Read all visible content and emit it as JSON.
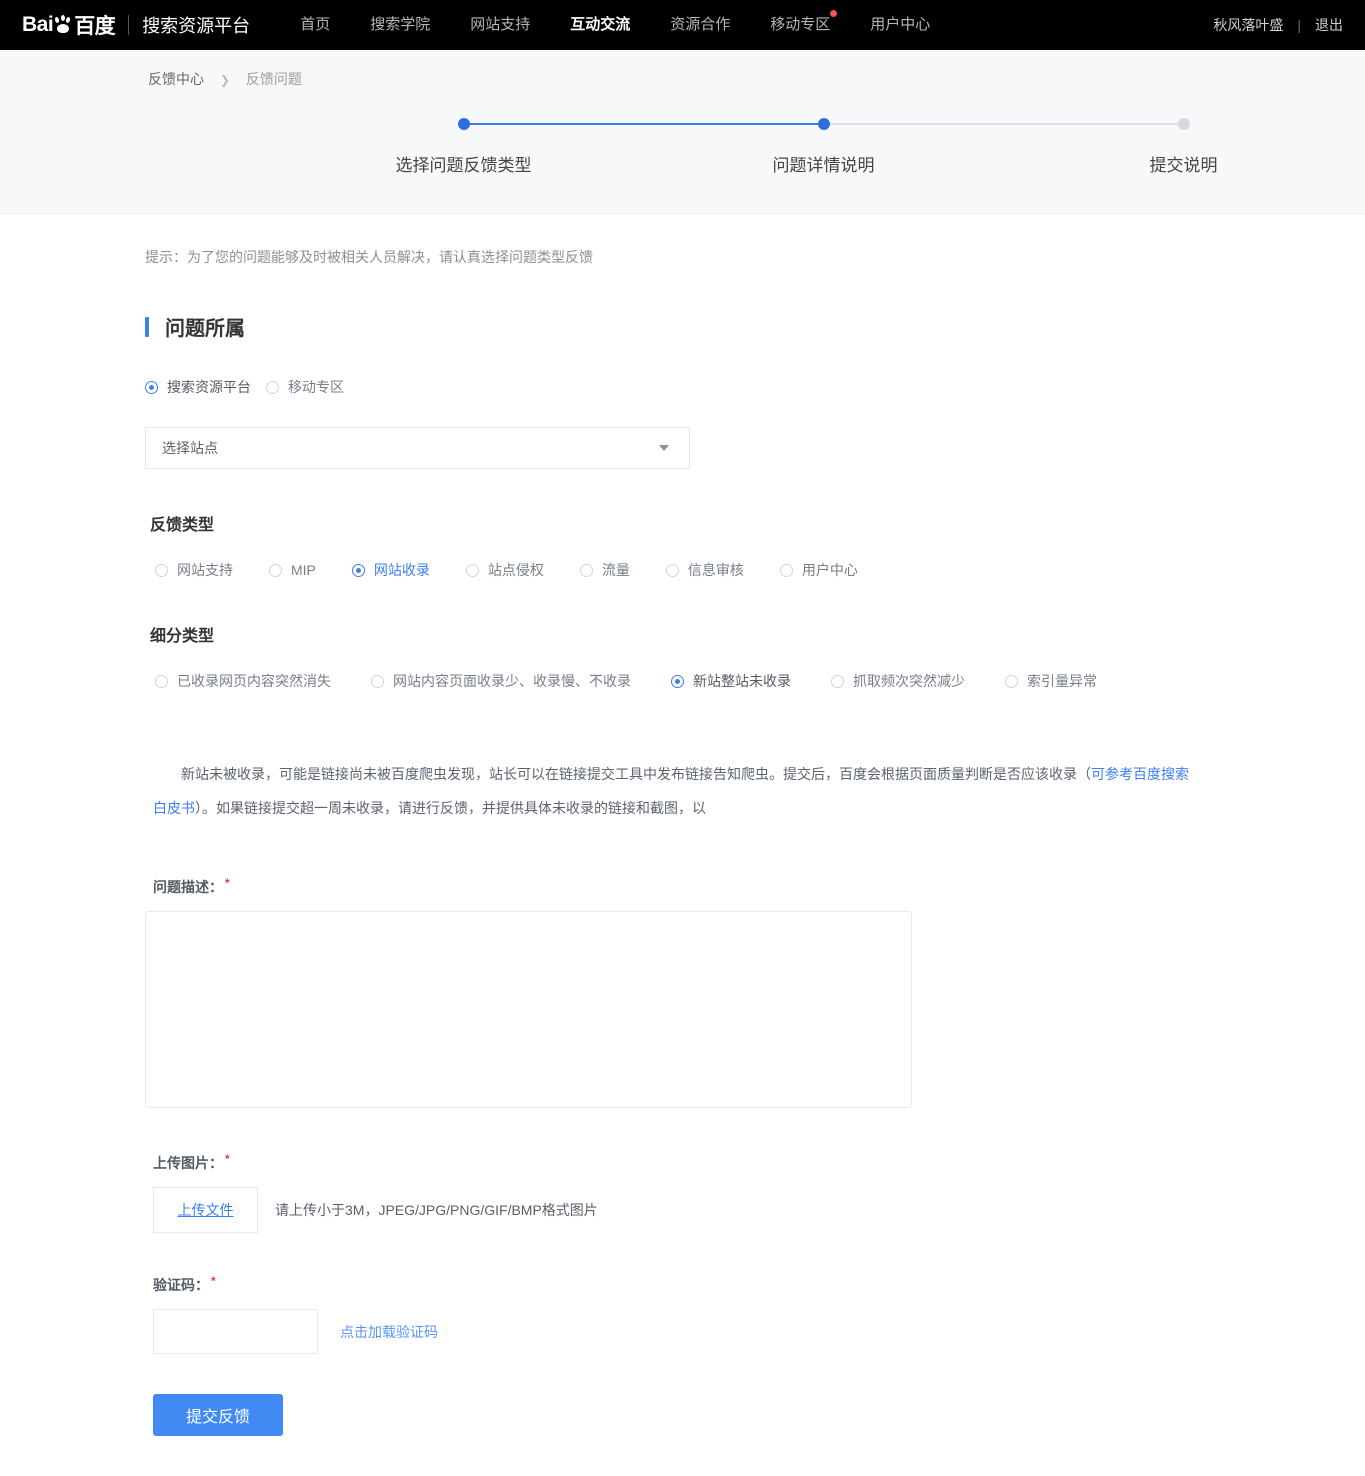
{
  "nav": {
    "brand": "搜索资源平台",
    "logo_text": "Bai  百度",
    "logo_left": "Bai",
    "logo_right": "百度",
    "links": [
      {
        "label": "首页",
        "active": false,
        "dot": false
      },
      {
        "label": "搜索学院",
        "active": false,
        "dot": false
      },
      {
        "label": "网站支持",
        "active": false,
        "dot": false
      },
      {
        "label": "互动交流",
        "active": true,
        "dot": false
      },
      {
        "label": "资源合作",
        "active": false,
        "dot": false
      },
      {
        "label": "移动专区",
        "active": false,
        "dot": true
      },
      {
        "label": "用户中心",
        "active": false,
        "dot": false
      }
    ],
    "username": "秋风落叶盛",
    "separator": "|",
    "logout": "退出"
  },
  "breadcrumb": {
    "root": "反馈中心",
    "separator": "❯",
    "current": "反馈问题"
  },
  "stepper": {
    "steps": [
      {
        "label": "选择问题反馈类型",
        "state": "done"
      },
      {
        "label": "问题详情说明",
        "state": "active"
      },
      {
        "label": "提交说明",
        "state": "todo"
      }
    ]
  },
  "tip": "提示：为了您的问题能够及时被相关人员解决，请认真选择问题类型反馈",
  "section": {
    "title": "问题所属",
    "owner_options": [
      {
        "label": "搜索资源平台",
        "selected": true
      },
      {
        "label": "移动专区",
        "selected": false
      }
    ],
    "site_select": {
      "value": "选择站点"
    },
    "feedback_type": {
      "title": "反馈类型",
      "options": [
        {
          "label": "网站支持",
          "selected": false
        },
        {
          "label": "MIP",
          "selected": false
        },
        {
          "label": "网站收录",
          "selected": true
        },
        {
          "label": "站点侵权",
          "selected": false
        },
        {
          "label": "流量",
          "selected": false
        },
        {
          "label": "信息审核",
          "selected": false
        },
        {
          "label": "用户中心",
          "selected": false
        }
      ]
    },
    "sub_type": {
      "title": "细分类型",
      "options": [
        {
          "label": "已收录网页内容突然消失",
          "selected": false
        },
        {
          "label": "网站内容页面收录少、收录慢、不收录",
          "selected": false
        },
        {
          "label": "新站整站未收录",
          "selected": true
        },
        {
          "label": "抓取频次突然减少",
          "selected": false
        },
        {
          "label": "索引量异常",
          "selected": false
        }
      ]
    }
  },
  "description_block": {
    "part1": "新站未被收录，可能是链接尚未被百度爬虫发现，站长可以在链接提交工具中发布链接告知爬虫。提交后，百度会根据页面质量判断是否应该收录（",
    "link": "可参考百度搜索白皮书",
    "part2": "）。如果链接提交超一周未收录，请进行反馈，并提供具体未收录的链接和截图，以"
  },
  "form": {
    "desc_label": "问题描述：",
    "desc_required": "*",
    "desc_value": "",
    "desc_placeholder": "",
    "upload_label": "上传图片：",
    "upload_required": "*",
    "upload_button": "上传文件",
    "upload_hint": "请上传小于3M，JPEG/JPG/PNG/GIF/BMP格式图片",
    "captcha_label": "验证码：",
    "captcha_required": "*",
    "captcha_value": "",
    "captcha_link": "点击加载验证码",
    "submit": "提交反馈"
  },
  "colors": {
    "accent": "#3c7ff0",
    "submit_bg": "#4189f3",
    "nav_bg": "#000000",
    "band_bg": "#f7f8fa",
    "required": "#e4393c",
    "dot_badge": "#f0564a"
  }
}
